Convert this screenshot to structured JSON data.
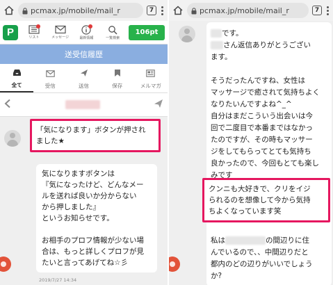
{
  "browser": {
    "url": "pcmax.jp/mobile/mail_r",
    "tabs_count": "7"
  },
  "app_header": {
    "logo": "P",
    "nav": [
      {
        "label": "リスト",
        "icon": "list-icon"
      },
      {
        "label": "メッセージ",
        "icon": "envelope-icon"
      },
      {
        "label": "最新情報",
        "icon": "info-icon"
      },
      {
        "label": "一覧検索",
        "icon": "search-icon"
      }
    ],
    "points": "106pt"
  },
  "title_bar": {
    "title": "送受信履歴"
  },
  "folder_tabs": [
    {
      "label": "全て",
      "icon": "inbox-icon",
      "active": true
    },
    {
      "label": "受信",
      "icon": "envelope-icon"
    },
    {
      "label": "送信",
      "icon": "send-icon"
    },
    {
      "label": "保存",
      "icon": "bookmark-icon"
    },
    {
      "label": "メルマガ",
      "icon": "newsletter-icon"
    }
  ],
  "left_chat": {
    "highlight_message": "「気になります」ボタンが押され\nました★",
    "info_message": "気になりますボタンは\n『気になったけど、どんなメー\nルを送れば良いか分からない\nから押しました』\nというお知らせです。\n\nお相手のプロフ情報が少ない場\n合は、もっと詳しくプロフが見\nたいと言ってあげてね☆彡",
    "timestamp": "2019/7/27 14:34"
  },
  "right_chat": {
    "line1": "です。",
    "line2a": "さん返信ありがとうござい",
    "line2b": "ます。",
    "para2": "そうだったんですね、女性は\nマッサージで癒されて気持ちよく\nなりたいんですよね^_^\n自分はまだこういう出会いは今\n回で二度目で本番まではなかっ\nたのですが、その時もマッサー\nジをしてもらってとても気持ち\n良かったので、今回もとても楽し\nみです",
    "highlight": "クンニも大好きで、クリをイジ\nられるのを想像して今から気持\nちよくなっています笑",
    "para3a": "私は",
    "para3b": "の間辺りに住",
    "para3c": "んでいるので、、中間辺りだと\n都内のどの辺りがいいでしょう\nか?"
  }
}
